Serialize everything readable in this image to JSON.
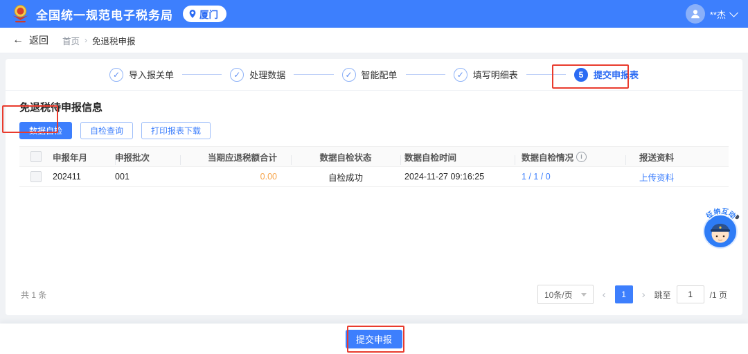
{
  "topbar": {
    "title": "全国统一规范电子税务局",
    "location": "厦门",
    "user": "**杰"
  },
  "breadcrumb": {
    "back": "返回",
    "home": "首页",
    "current": "免退税申报"
  },
  "stepper": {
    "steps": [
      {
        "label": "导入报关单",
        "state": "done"
      },
      {
        "label": "处理数据",
        "state": "done"
      },
      {
        "label": "智能配单",
        "state": "done"
      },
      {
        "label": "填写明细表",
        "state": "done"
      },
      {
        "label": "提交申报表",
        "state": "active",
        "number": "5"
      }
    ]
  },
  "panel": {
    "title": "免退税待申报信息",
    "self_check_btn": "数据自检",
    "query_btn": "自检查询",
    "print_btn": "打印报表下载"
  },
  "table": {
    "headers": {
      "ym": "申报年月",
      "batch": "申报批次",
      "amount": "当期应退税额合计",
      "status": "数据自检状态",
      "time": "数据自检时间",
      "situation": "数据自检情况",
      "material": "报送资料"
    },
    "rows": [
      {
        "ym": "202411",
        "batch": "001",
        "amount": "0.00",
        "status": "自检成功",
        "time": "2024-11-27 09:16:25",
        "situation": "1 / 1 / 0",
        "material": "上传资料"
      }
    ],
    "total": "共 1 条"
  },
  "pagination": {
    "page_size": "10条/页",
    "current_page": "1",
    "jump_label": "跳至",
    "jump_value": "1",
    "suffix": "/1 页"
  },
  "footer": {
    "submit": "提交申报"
  },
  "mascot": {
    "label": "征纳互动"
  },
  "icons": {
    "back_arrow": "←",
    "separator": "›",
    "check": "✓",
    "info": "i",
    "prev": "‹",
    "next": "›"
  },
  "colors": {
    "primary": "#3d7ffd",
    "active_step_blue": "#2b6bf3",
    "amount_orange": "#f7a44a",
    "annotation_red": "#e93b2d"
  }
}
